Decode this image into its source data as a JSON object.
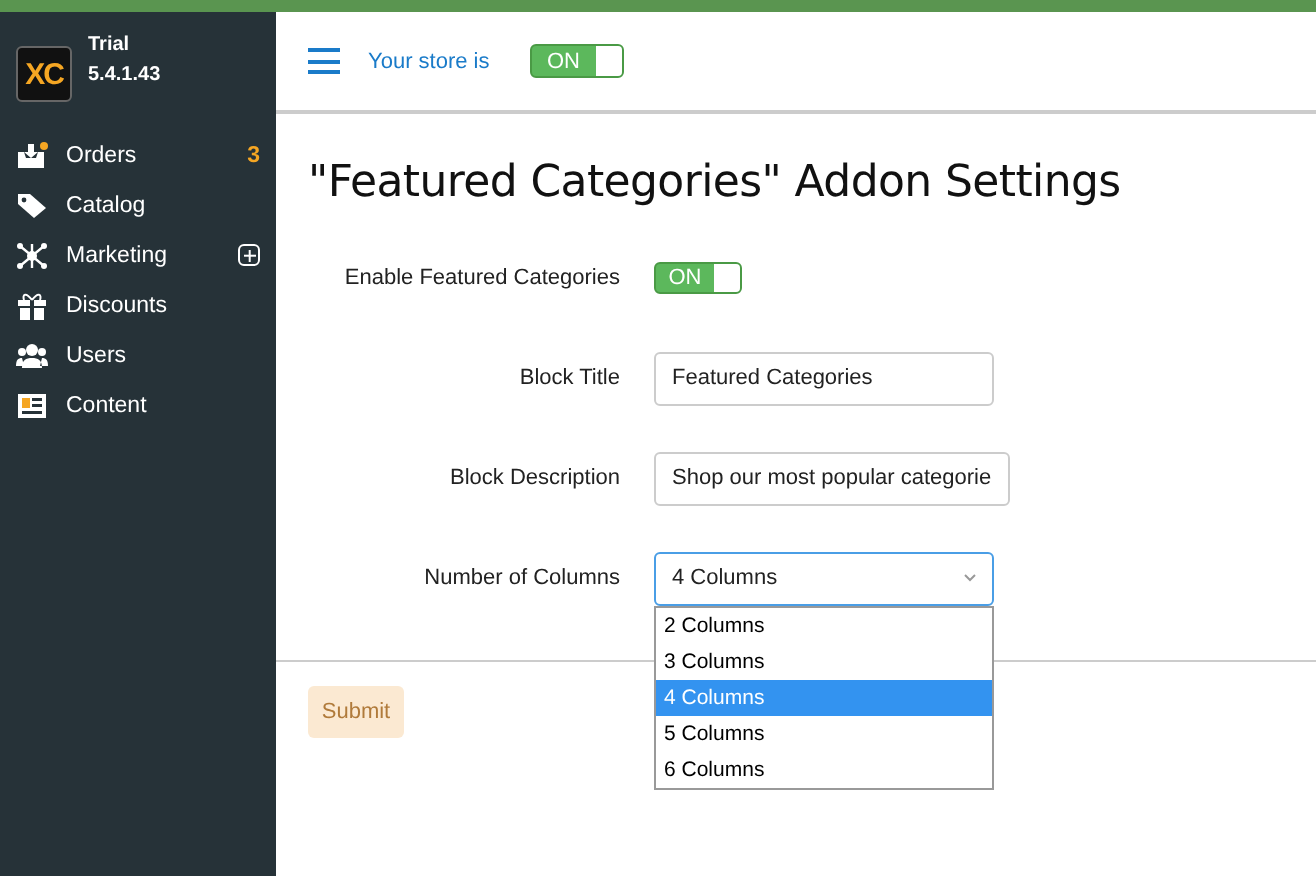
{
  "sidebar": {
    "logo": "XC",
    "plan": "Trial",
    "version": "5.4.1.43",
    "items": [
      {
        "label": "Orders",
        "badge": "3",
        "expandable": false
      },
      {
        "label": "Catalog",
        "expandable": false
      },
      {
        "label": "Marketing",
        "expandable": true
      },
      {
        "label": "Discounts",
        "expandable": false
      },
      {
        "label": "Users",
        "expandable": false
      },
      {
        "label": "Content",
        "expandable": false
      }
    ]
  },
  "header": {
    "store_label": "Your store is",
    "store_toggle": {
      "label": "ON",
      "on": true
    }
  },
  "settings": {
    "title": "\"Featured Categories\" Addon Settings",
    "fields": [
      {
        "kind": "toggle",
        "label": "Enable Featured Categories",
        "value": "ON",
        "on": true
      },
      {
        "kind": "text",
        "label": "Block Title",
        "value": "Featured Categories"
      },
      {
        "kind": "text",
        "label": "Block Description",
        "value": "Shop our most popular categorie"
      },
      {
        "kind": "select",
        "label": "Number of Columns",
        "value": "4 Columns",
        "expanded": true,
        "options": [
          {
            "label": "2 Columns",
            "selected": false
          },
          {
            "label": "3 Columns",
            "selected": false
          },
          {
            "label": "4 Columns",
            "selected": true
          },
          {
            "label": "5 Columns",
            "selected": false
          },
          {
            "label": "6 Columns",
            "selected": false
          }
        ]
      }
    ],
    "submit": {
      "label": "Submit",
      "disabled": true
    }
  }
}
